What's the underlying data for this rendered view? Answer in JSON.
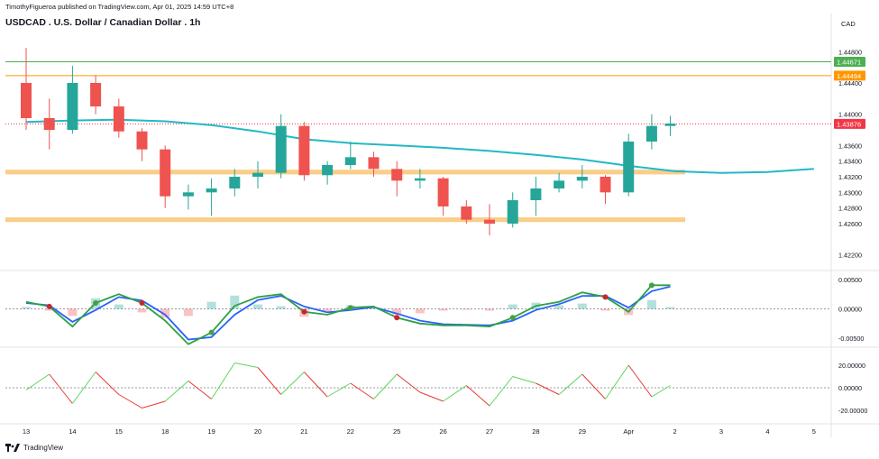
{
  "header": {
    "publish_line": "TimothyFigueroa published on TradingView.com, Apr 01, 2025 14:59 UTC+8",
    "title": "USDCAD . U.S. Dollar / Canadian Dollar . 1h",
    "currency": "CAD",
    "brand": "TradingView"
  },
  "colors": {
    "up": "#26a69a",
    "down": "#ef5350",
    "ma": "#22b8c7",
    "zone": "#f7c26b",
    "green_line": "#4caf50",
    "orange_line": "#ff9800",
    "last_price": "#f23645",
    "rsi_up": "#5cd65c",
    "rsi_down": "#e53935",
    "macd_fast": "#2ea043",
    "macd_slow": "#2962ff"
  },
  "chart_data": [
    {
      "type": "candlestick",
      "title": "USDCAD . U.S. Dollar / Canadian Dollar . 1h",
      "x_ticks": [
        "13",
        "14",
        "15",
        "18",
        "19",
        "20",
        "21",
        "22",
        "25",
        "26",
        "27",
        "28",
        "29",
        "Apr",
        "2",
        "3",
        "4",
        "5"
      ],
      "y_ticks": [
        "1.44800",
        "1.44400",
        "1.44000",
        "1.43600",
        "1.43400",
        "1.43200",
        "1.43000",
        "1.42800",
        "1.42600",
        "1.42200"
      ],
      "ylim": [
        1.42,
        1.45
      ],
      "price_labels": [
        {
          "label": "1.44671",
          "value": 1.44671,
          "color": "#4caf50"
        },
        {
          "label": "1.44494",
          "value": 1.44494,
          "color": "#ff9800"
        },
        {
          "label": "1.43876",
          "value": 1.43876,
          "color": "#f23645"
        }
      ],
      "zones": [
        {
          "low": 1.4323,
          "high": 1.4329
        },
        {
          "low": 1.4262,
          "high": 1.4268
        }
      ],
      "moving_average": [
        {
          "x": 0,
          "y": 1.439
        },
        {
          "x": 1,
          "y": 1.4392
        },
        {
          "x": 2,
          "y": 1.4393
        },
        {
          "x": 3,
          "y": 1.4391
        },
        {
          "x": 4,
          "y": 1.4386
        },
        {
          "x": 5,
          "y": 1.4378
        },
        {
          "x": 6,
          "y": 1.4368
        },
        {
          "x": 7,
          "y": 1.4363
        },
        {
          "x": 8,
          "y": 1.436
        },
        {
          "x": 9,
          "y": 1.4357
        },
        {
          "x": 10,
          "y": 1.4353
        },
        {
          "x": 11,
          "y": 1.4348
        },
        {
          "x": 12,
          "y": 1.4342
        },
        {
          "x": 13,
          "y": 1.4334
        },
        {
          "x": 14,
          "y": 1.4327
        },
        {
          "x": 15,
          "y": 1.4325
        },
        {
          "x": 16,
          "y": 1.4326
        },
        {
          "x": 17,
          "y": 1.433
        }
      ],
      "series": [
        {
          "x": 0,
          "o": 1.444,
          "h": 1.4485,
          "l": 1.438,
          "c": 1.4395
        },
        {
          "x": 0.5,
          "o": 1.4395,
          "h": 1.442,
          "l": 1.4355,
          "c": 1.438
        },
        {
          "x": 1,
          "o": 1.438,
          "h": 1.4462,
          "l": 1.4375,
          "c": 1.444
        },
        {
          "x": 1.5,
          "o": 1.444,
          "h": 1.445,
          "l": 1.44,
          "c": 1.441
        },
        {
          "x": 2,
          "o": 1.441,
          "h": 1.442,
          "l": 1.437,
          "c": 1.4378
        },
        {
          "x": 2.5,
          "o": 1.4378,
          "h": 1.4382,
          "l": 1.434,
          "c": 1.4355
        },
        {
          "x": 3,
          "o": 1.4355,
          "h": 1.436,
          "l": 1.428,
          "c": 1.4295
        },
        {
          "x": 3.5,
          "o": 1.4295,
          "h": 1.431,
          "l": 1.4278,
          "c": 1.43
        },
        {
          "x": 4,
          "o": 1.43,
          "h": 1.4318,
          "l": 1.427,
          "c": 1.4305
        },
        {
          "x": 4.5,
          "o": 1.4305,
          "h": 1.433,
          "l": 1.4295,
          "c": 1.432
        },
        {
          "x": 5,
          "o": 1.432,
          "h": 1.434,
          "l": 1.4305,
          "c": 1.4325
        },
        {
          "x": 5.5,
          "o": 1.4325,
          "h": 1.44,
          "l": 1.4318,
          "c": 1.4385
        },
        {
          "x": 6,
          "o": 1.4385,
          "h": 1.439,
          "l": 1.4315,
          "c": 1.4322
        },
        {
          "x": 6.5,
          "o": 1.4322,
          "h": 1.434,
          "l": 1.431,
          "c": 1.4335
        },
        {
          "x": 7,
          "o": 1.4335,
          "h": 1.4365,
          "l": 1.433,
          "c": 1.4345
        },
        {
          "x": 7.5,
          "o": 1.4345,
          "h": 1.4352,
          "l": 1.432,
          "c": 1.433
        },
        {
          "x": 8,
          "o": 1.433,
          "h": 1.434,
          "l": 1.4295,
          "c": 1.4315
        },
        {
          "x": 8.5,
          "o": 1.4315,
          "h": 1.433,
          "l": 1.4305,
          "c": 1.4318
        },
        {
          "x": 9,
          "o": 1.4318,
          "h": 1.432,
          "l": 1.427,
          "c": 1.4282
        },
        {
          "x": 9.5,
          "o": 1.4282,
          "h": 1.429,
          "l": 1.426,
          "c": 1.4265
        },
        {
          "x": 10,
          "o": 1.4265,
          "h": 1.4285,
          "l": 1.4245,
          "c": 1.426
        },
        {
          "x": 10.5,
          "o": 1.426,
          "h": 1.43,
          "l": 1.4255,
          "c": 1.429
        },
        {
          "x": 11,
          "o": 1.429,
          "h": 1.432,
          "l": 1.427,
          "c": 1.4305
        },
        {
          "x": 11.5,
          "o": 1.4305,
          "h": 1.4325,
          "l": 1.43,
          "c": 1.4315
        },
        {
          "x": 12,
          "o": 1.4315,
          "h": 1.4335,
          "l": 1.4305,
          "c": 1.432
        },
        {
          "x": 12.5,
          "o": 1.432,
          "h": 1.4322,
          "l": 1.4285,
          "c": 1.43
        },
        {
          "x": 13,
          "o": 1.43,
          "h": 1.4375,
          "l": 1.4295,
          "c": 1.4365
        },
        {
          "x": 13.5,
          "o": 1.4365,
          "h": 1.44,
          "l": 1.4355,
          "c": 1.4385
        },
        {
          "x": 13.9,
          "o": 1.4385,
          "h": 1.4398,
          "l": 1.4372,
          "c": 1.4388
        }
      ]
    },
    {
      "type": "line",
      "title": "",
      "y_ticks": [
        "0.00500",
        "0.00000",
        "-0.00500"
      ],
      "ylim": [
        -0.0065,
        0.0065
      ],
      "series": [
        {
          "name": "",
          "x": [
            0,
            0.5,
            1,
            1.5,
            2,
            2.5,
            3,
            3.5,
            4,
            4.5,
            5,
            5.5,
            6,
            6.5,
            7,
            7.5,
            8,
            8.5,
            9,
            9.5,
            10,
            10.5,
            11,
            11.5,
            12,
            12.5,
            13,
            13.5,
            13.9
          ],
          "values": [
            0.0012,
            0.0004,
            -0.003,
            0.001,
            0.0025,
            0.001,
            -0.002,
            -0.006,
            -0.004,
            0.0005,
            0.002,
            0.0025,
            -0.0005,
            -0.001,
            0.0002,
            0.0004,
            -0.0015,
            -0.0025,
            -0.0028,
            -0.0028,
            -0.003,
            -0.0015,
            0.0005,
            0.0012,
            0.0028,
            0.002,
            -0.0005,
            0.004,
            0.004
          ]
        },
        {
          "name": "",
          "x": [
            0,
            0.5,
            1,
            1.5,
            2,
            2.5,
            3,
            3.5,
            4,
            4.5,
            5,
            5.5,
            6,
            6.5,
            7,
            7.5,
            8,
            8.5,
            9,
            9.5,
            10,
            10.5,
            11,
            11.5,
            12,
            12.5,
            13,
            13.5,
            13.9
          ],
          "values": [
            0.001,
            0.0006,
            -0.0022,
            -0.0002,
            0.002,
            0.0014,
            -0.001,
            -0.0052,
            -0.0048,
            -0.001,
            0.0015,
            0.0022,
            0.0004,
            -0.0006,
            -0.0002,
            0.0003,
            -0.0008,
            -0.002,
            -0.0026,
            -0.0027,
            -0.0028,
            -0.002,
            -0.0002,
            0.0008,
            0.0022,
            0.0022,
            0.0002,
            0.003,
            0.0038
          ]
        }
      ]
    },
    {
      "type": "line",
      "title": "",
      "y_ticks": [
        "20.00000",
        "0.00000",
        "-20.00000"
      ],
      "ylim": [
        -32,
        36
      ],
      "series": [
        {
          "name": "",
          "x": [
            0,
            0.5,
            1,
            1.5,
            2,
            2.5,
            3,
            3.5,
            4,
            4.5,
            5,
            5.5,
            6,
            6.5,
            7,
            7.5,
            8,
            8.5,
            9,
            9.5,
            10,
            10.5,
            11,
            11.5,
            12,
            12.5,
            13,
            13.5,
            13.9
          ],
          "values": [
            -2,
            12,
            -14,
            14,
            -6,
            -18,
            -12,
            6,
            -10,
            22,
            18,
            -6,
            14,
            -8,
            4,
            -10,
            12,
            -4,
            -12,
            2,
            -16,
            10,
            4,
            -6,
            12,
            -10,
            20,
            -8,
            2
          ]
        }
      ]
    }
  ]
}
